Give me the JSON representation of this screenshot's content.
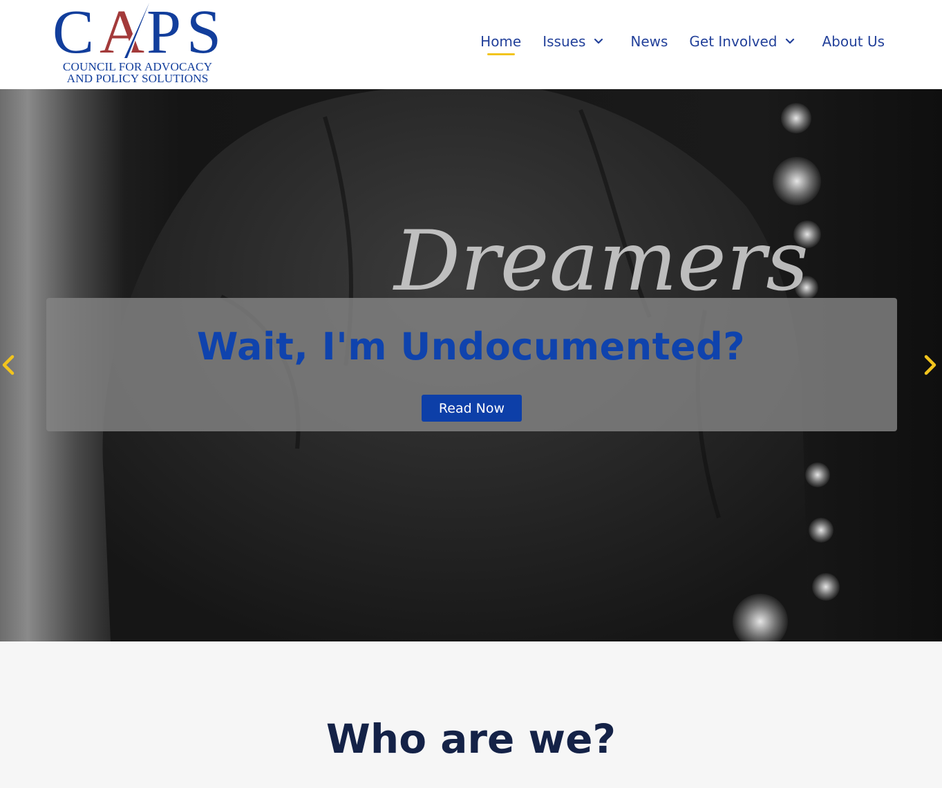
{
  "brand": {
    "logo_letters": [
      "C",
      "A",
      "P",
      "S"
    ],
    "tagline_line1": "COUNCIL FOR ADVOCACY",
    "tagline_line2": "AND POLICY SOLUTIONS",
    "primary_color": "#123e9c",
    "accent_color": "#a33a3a"
  },
  "nav": {
    "items": [
      {
        "label": "Home",
        "active": true,
        "dropdown": false
      },
      {
        "label": "Issues",
        "active": false,
        "dropdown": true
      },
      {
        "label": "News",
        "active": false,
        "dropdown": false
      },
      {
        "label": "Get Involved",
        "active": false,
        "dropdown": true
      },
      {
        "label": "About Us",
        "active": false,
        "dropdown": false
      }
    ],
    "active_underline_color": "#f2c41d"
  },
  "hero": {
    "jacket_text": "Dreamers",
    "title": "Wait, I'm Undocumented?",
    "button_label": "Read Now",
    "prev_icon": "chevron-left-icon",
    "next_icon": "chevron-right-icon",
    "arrow_color": "#f2c41d"
  },
  "about": {
    "title": "Who are we?"
  }
}
